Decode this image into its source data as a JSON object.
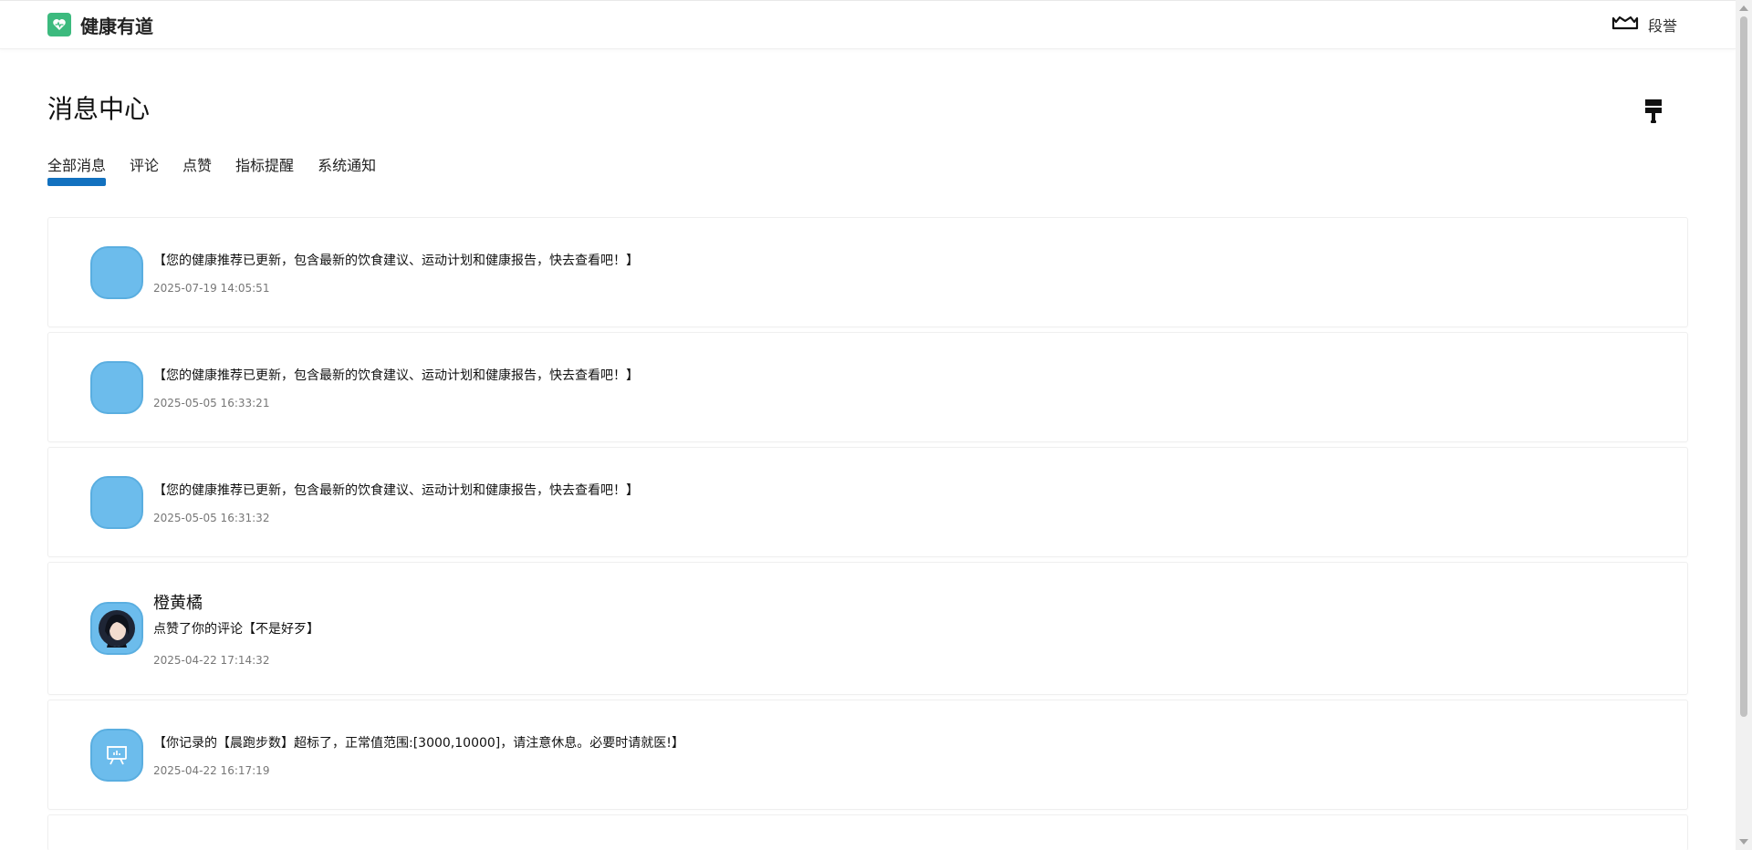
{
  "header": {
    "brand_name": "健康有道",
    "user_name": "段誉"
  },
  "page": {
    "title": "消息中心"
  },
  "tabs": [
    {
      "label": "全部消息",
      "active": true
    },
    {
      "label": "评论",
      "active": false
    },
    {
      "label": "点赞",
      "active": false
    },
    {
      "label": "指标提醒",
      "active": false
    },
    {
      "label": "系统通知",
      "active": false
    }
  ],
  "messages": [
    {
      "type": "system",
      "text": "【您的健康推荐已更新，包含最新的饮食建议、运动计划和健康报告，快去查看吧！】",
      "time": "2025-07-19 14:05:51"
    },
    {
      "type": "system",
      "text": "【您的健康推荐已更新，包含最新的饮食建议、运动计划和健康报告，快去查看吧！】",
      "time": "2025-05-05 16:33:21"
    },
    {
      "type": "system",
      "text": "【您的健康推荐已更新，包含最新的饮食建议、运动计划和健康报告，快去查看吧！】",
      "time": "2025-05-05 16:31:32"
    },
    {
      "type": "like",
      "sender": "橙黄橘",
      "text": "点赞了你的评论【不是好歹】",
      "time": "2025-04-22 17:14:32"
    },
    {
      "type": "indicator",
      "text": "【你记录的【晨跑步数】超标了，正常值范围:[3000,10000]，请注意休息。必要时请就医!】",
      "time": "2025-04-22 16:17:19"
    }
  ],
  "colors": {
    "brand_green": "#3cba7e",
    "tab_active": "#1271bf",
    "avatar_blue": "#6cbcec"
  },
  "icons": {
    "logo": "heart-pulse-icon",
    "user": "crown-icon",
    "clear": "brush-icon",
    "indicator": "presentation-chart-icon"
  }
}
